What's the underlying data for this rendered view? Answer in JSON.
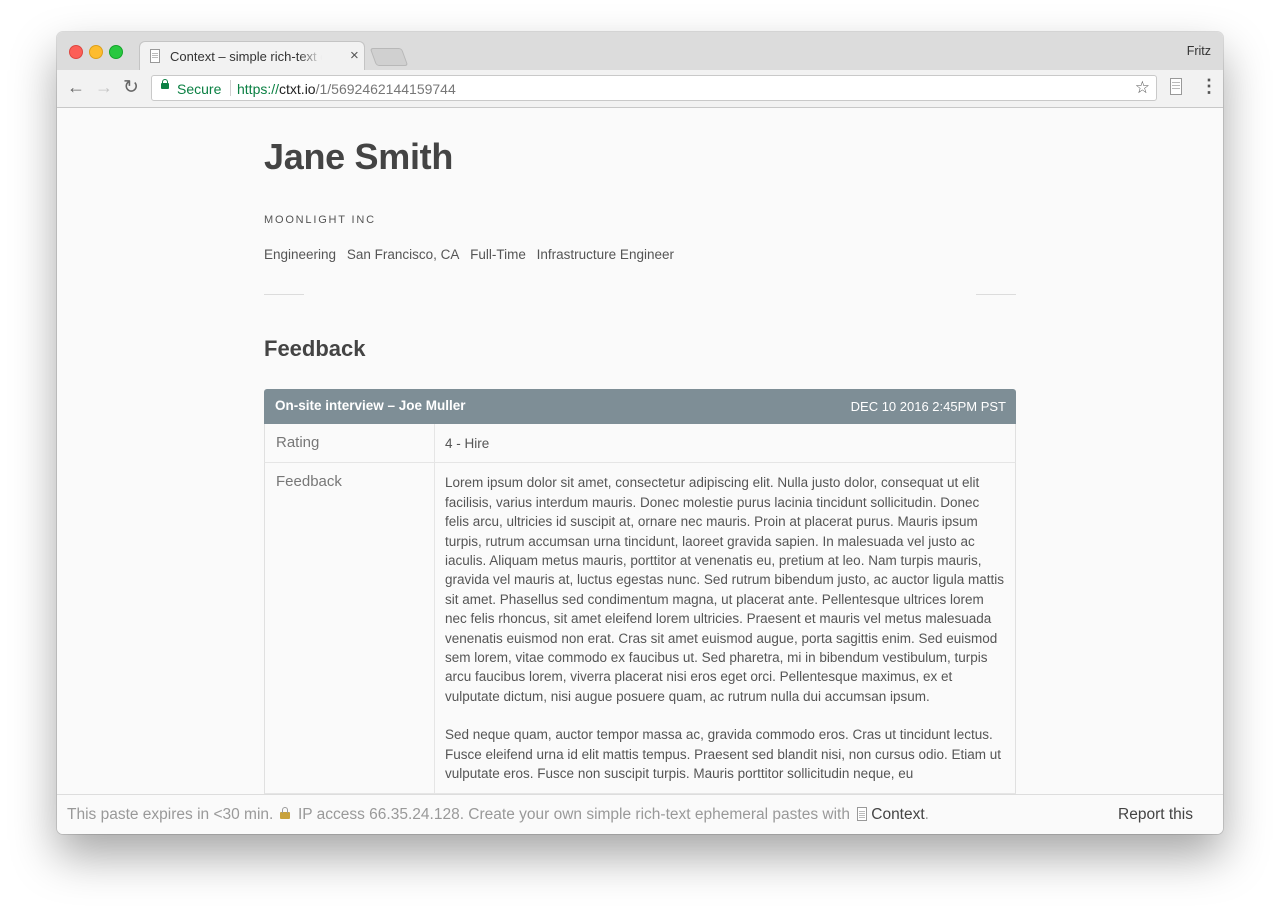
{
  "browser": {
    "tab_title": "Context – simple rich-text ephemeral pastes",
    "tab_close": "×",
    "profile_name": "Fritz",
    "secure_label": "Secure",
    "url_scheme": "https://",
    "url_host": "ctxt.io",
    "url_path": "/1/5692462144159744",
    "icons": {
      "back": "arrow-left",
      "forward": "arrow-right",
      "reload": "reload",
      "bookmark": "star",
      "extension": "document",
      "menu": "kebab-menu"
    }
  },
  "profile": {
    "name": "Jane Smith",
    "company": "MOONLIGHT INC",
    "tags": [
      "Engineering",
      "San Francisco, CA",
      "Full-Time",
      "Infrastructure Engineer"
    ]
  },
  "feedback": {
    "heading": "Feedback",
    "card": {
      "title": "On-site interview – Joe Muller",
      "date": "DEC 10 2016 2:45PM PST",
      "header_color": "#7e8e96",
      "rating_label": "Rating",
      "rating_value": "4 - Hire",
      "feedback_label": "Feedback",
      "paragraphs": [
        "Lorem ipsum dolor sit amet, consectetur adipiscing elit. Nulla justo dolor, consequat ut elit facilisis, varius interdum mauris. Donec molestie purus lacinia tincidunt sollicitudin. Donec felis arcu, ultricies id suscipit at, ornare nec mauris. Proin at placerat purus. Mauris ipsum turpis, rutrum accumsan urna tincidunt, laoreet gravida sapien. In malesuada vel justo ac iaculis. Aliquam metus mauris, porttitor at venenatis eu, pretium at leo. Nam turpis mauris, gravida vel mauris at, luctus egestas nunc. Sed rutrum bibendum justo, ac auctor ligula mattis sit amet. Phasellus sed condimentum magna, ut placerat ante. Pellentesque ultrices lorem nec felis rhoncus, sit amet eleifend lorem ultricies. Praesent et mauris vel metus malesuada venenatis euismod non erat. Cras sit amet euismod augue, porta sagittis enim. Sed euismod sem lorem, vitae commodo ex faucibus ut. Sed pharetra, mi in bibendum vestibulum, turpis arcu faucibus lorem, viverra placerat nisi eros eget orci. Pellentesque maximus, ex et vulputate dictum, nisi augue posuere quam, ac rutrum nulla dui accumsan ipsum.",
        "Sed neque quam, auctor tempor massa ac, gravida commodo eros. Cras ut tincidunt lectus. Fusce eleifend urna id elit mattis tempus. Praesent sed blandit nisi, non cursus odio. Etiam ut vulputate eros. Fusce non suscipit turpis. Mauris porttitor sollicitudin neque, eu"
      ]
    }
  },
  "footer": {
    "expires_text": "This paste expires in <30 min.",
    "ip_text": "IP access 66.35.24.128. Create your own simple rich-text ephemeral pastes with",
    "brand": "Context",
    "brand_suffix": ".",
    "report": "Report this"
  }
}
